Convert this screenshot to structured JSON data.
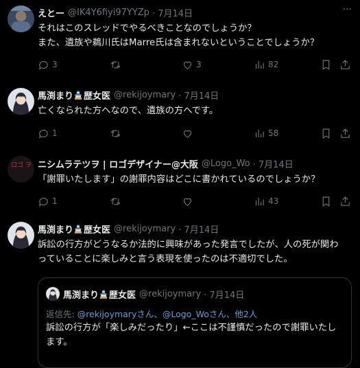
{
  "tweets": [
    {
      "name": "えとー",
      "handle": "@IK4Y6fiyi97YYZp",
      "date": "· 7月14日",
      "lines": [
        "それはこのスレッドでやるべきことなのでしょうか？",
        "また、遺族や鵜川氏はMarre氏は含まれないということでしょうか？"
      ],
      "replies": "3",
      "retweets": "",
      "likes": "3",
      "views": "82"
    },
    {
      "name": "馬渕まり",
      "name_suffix": "歴女医",
      "handle": "@rekijoymary",
      "date": "· 7月14日",
      "lines": [
        "亡くなられた方へなので、遺族の方へです。"
      ],
      "replies": "1",
      "retweets": "",
      "likes": "",
      "views": "58"
    },
    {
      "name": "ニシムラテツヲ | ロゴデザイナー@大阪",
      "handle": "@Logo_Wo",
      "date": "· 7月14日",
      "lines": [
        "「謝罪いたします」の謝罪内容はどこに書かれているのでしょうか？"
      ],
      "replies": "1",
      "retweets": "",
      "likes": "",
      "views": "43",
      "avatar_text": "ロゴ ヲ"
    },
    {
      "name": "馬渕まり",
      "name_suffix": "歴女医",
      "handle": "@rekijoymary",
      "date": "· 7月14日",
      "lines": [
        "訴訟の行方がどうなるか法的に興味があった発言でしたが、人の死が関わ",
        "っていることに楽しみと言う表現を使ったのは不適切でした。"
      ]
    }
  ],
  "quote": {
    "name": "馬渕まり",
    "name_suffix": "歴女医",
    "handle": "@rekijoymary",
    "date": "· 7月14日",
    "reply_prefix": "返信先: ",
    "reply_users": "@rekijoymaryさん、@Logo_Woさん、他2人",
    "lines": [
      "訴訟の行方が「楽しみだったり」←ここは不謹慎だったので謝罪いたし",
      "ます。"
    ]
  },
  "icons": [
    "more-icon",
    "reply-icon",
    "retweet-icon",
    "like-icon",
    "views-icon",
    "bookmark-icon",
    "share-icon",
    "castle-emoji"
  ]
}
